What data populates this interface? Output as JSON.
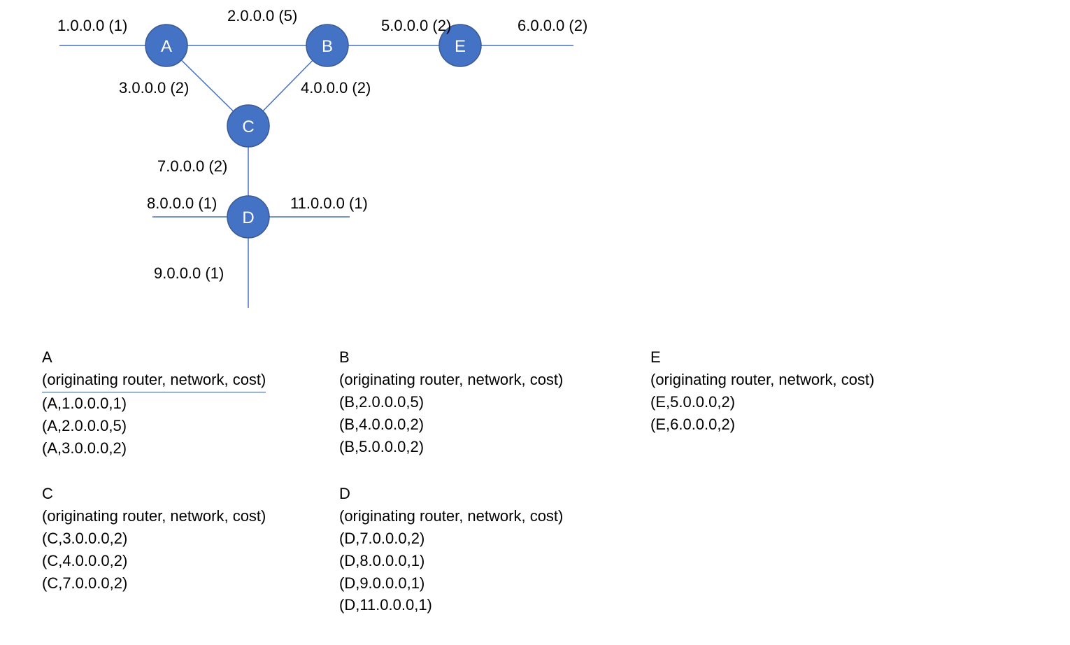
{
  "nodes": {
    "A": "A",
    "B": "B",
    "C": "C",
    "D": "D",
    "E": "E"
  },
  "edges": {
    "e1": "1.0.0.0 (1)",
    "e2": "2.0.0.0 (5)",
    "e3": "3.0.0.0 (2)",
    "e4": "4.0.0.0 (2)",
    "e5": "5.0.0.0 (2)",
    "e6": "6.0.0.0 (2)",
    "e7": "7.0.0.0 (2)",
    "e8": "8.0.0.0 (1)",
    "e9": "9.0.0.0 (1)",
    "e11": "11.0.0.0 (1)"
  },
  "tables": {
    "A": {
      "name": "A",
      "header": "(originating router, network, cost)",
      "rows": [
        "(A,1.0.0.0,1)",
        "(A,2.0.0.0,5)",
        "(A,3.0.0.0,2)"
      ]
    },
    "B": {
      "name": "B",
      "header": "(originating router, network, cost)",
      "rows": [
        "(B,2.0.0.0,5)",
        "(B,4.0.0.0,2)",
        "(B,5.0.0.0,2)"
      ]
    },
    "E": {
      "name": "E",
      "header": "(originating router, network, cost)",
      "rows": [
        "(E,5.0.0.0,2)",
        "(E,6.0.0.0,2)"
      ]
    },
    "C": {
      "name": "C",
      "header": "(originating router, network, cost)",
      "rows": [
        "(C,3.0.0.0,2)",
        "(C,4.0.0.0,2)",
        "(C,7.0.0.0,2)"
      ]
    },
    "D": {
      "name": "D",
      "header": "(originating router, network, cost)",
      "rows": [
        "(D,7.0.0.0,2)",
        "(D,8.0.0.0,1)",
        "(D,9.0.0.0,1)",
        "(D,11.0.0.0,1)"
      ]
    }
  }
}
